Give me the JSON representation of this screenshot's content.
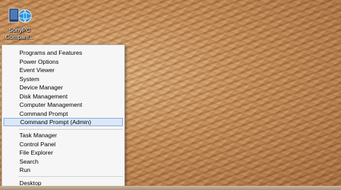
{
  "desktop": {
    "icon": {
      "name": "computer-globe-icon",
      "label_line1": "SonyPC",
      "label_line2": "Compani..."
    }
  },
  "menu": {
    "group1": [
      "Programs and Features",
      "Power Options",
      "Event Viewer",
      "System",
      "Device Manager",
      "Disk Management",
      "Computer Management",
      "Command Prompt",
      "Command Prompt (Admin)"
    ],
    "group2": [
      "Task Manager",
      "Control Panel",
      "File Explorer",
      "Search",
      "Run"
    ],
    "group3": [
      "Desktop"
    ],
    "selected": "Command Prompt (Admin)",
    "highlight_color": "#dbe8f7"
  }
}
